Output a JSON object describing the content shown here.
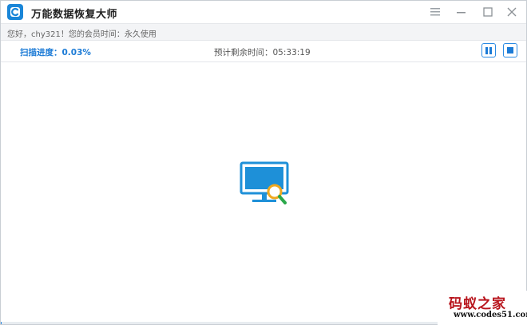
{
  "app": {
    "title": "万能数据恢复大师"
  },
  "greeting": {
    "text": "您好，chy321！您的会员时间：永久使用"
  },
  "scan": {
    "progress_label": "扫描进度：0.03%",
    "progress_percent": 0.03,
    "remaining_label": "预计剩余时间：05:33:19"
  },
  "watermark": {
    "logo_text": "码蚁之家",
    "url": "www.codes51.com"
  },
  "colors": {
    "accent": "#1c7bd6",
    "monitor": "#1e90d8",
    "magnifier": "#f0a81e",
    "handle": "#2ba84a",
    "watermark_red": "#b8141c"
  },
  "icons": {
    "app_logo": "app-logo-icon",
    "menu": "menu-icon",
    "minimize": "minimize-icon",
    "maximize": "maximize-icon",
    "close": "close-icon",
    "pause": "pause-icon",
    "stop": "stop-icon",
    "scan": "monitor-magnifier-icon"
  }
}
